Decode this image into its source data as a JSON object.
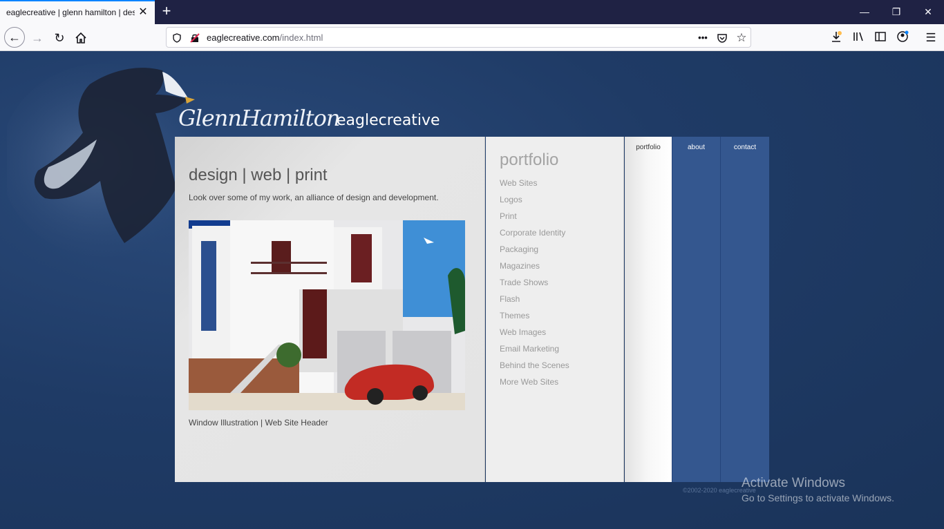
{
  "browser": {
    "tab_title": "eaglecreative | glenn hamilton | design",
    "url_domain": "eaglecreative.com",
    "url_path": "/index.html",
    "tab_close_glyph": "✕",
    "new_tab_glyph": "+",
    "window_controls": {
      "minimize": "—",
      "restore": "❐",
      "close": "✕"
    },
    "nav_icons": [
      "back-arrow-icon",
      "forward-arrow-icon",
      "reload-icon",
      "home-icon"
    ],
    "toolbar_icons": [
      "downloads-icon",
      "library-icon",
      "sidebar-icon",
      "account-icon",
      "menu-icon"
    ]
  },
  "site": {
    "signature": "GlennHamilton",
    "brand": "eaglecreative",
    "heading": "design | web | print",
    "intro": "Look over some of my work, an alliance of design and development.",
    "caption": "Window Illustration | Web Site Header",
    "sidebar_title": "portfolio",
    "sidebar_items": [
      "Web Sites",
      "Logos",
      "Print",
      "Corporate Identity",
      "Packaging",
      "Magazines",
      "Trade Shows",
      "Flash",
      "Themes",
      "Web Images",
      "Email Marketing",
      "Behind the Scenes",
      "More Web Sites"
    ],
    "tabs": {
      "portfolio": "portfolio",
      "about": "about",
      "contact": "contact"
    },
    "copyright": "©2002-2020 eaglecreative"
  },
  "os_overlay": {
    "line1": "Activate Windows",
    "line2": "Go to Settings to activate Windows."
  },
  "colors": {
    "page_bg": "#1f3b66",
    "tab_blue": "#34578f",
    "accent": "#0a84ff"
  }
}
